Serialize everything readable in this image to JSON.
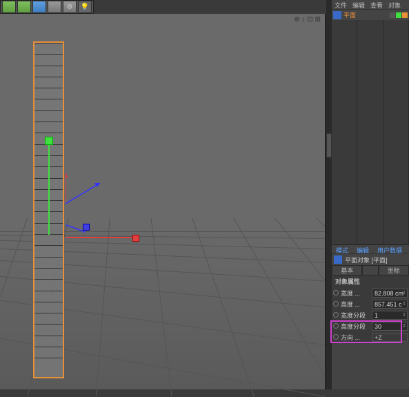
{
  "om_menu": {
    "file": "文件",
    "edit": "编辑",
    "view": "查看",
    "object": "对象"
  },
  "tree": {
    "item_label": "平面"
  },
  "attr_menu": {
    "mode": "模式",
    "edit": "编辑",
    "userdata": "用户数据"
  },
  "attr_header": "平面对象 [平面]",
  "tabs": {
    "basic": "基本",
    "coord": "坐标"
  },
  "section_title": "对象属性",
  "props": {
    "width": {
      "label": "宽度 ...",
      "value": "82.808 cm"
    },
    "height": {
      "label": "高度 ...",
      "value": "857.451 c"
    },
    "seg_w": {
      "label": "宽度分段",
      "value": "1"
    },
    "seg_h": {
      "label": "高度分段",
      "value": "30"
    },
    "orient": {
      "label": "方向 ...",
      "value": "+Z"
    }
  }
}
